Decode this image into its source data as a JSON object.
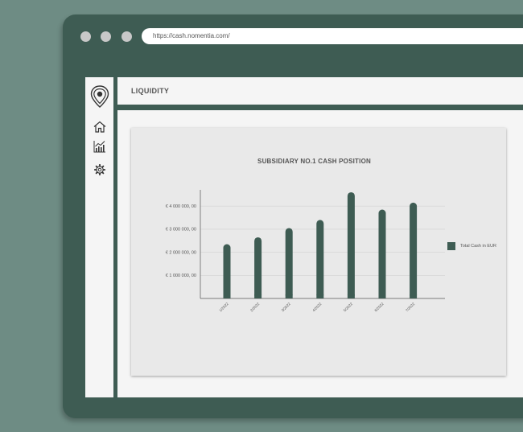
{
  "browser": {
    "url": "https://cash.nomentia.com/"
  },
  "sidebar": {
    "items": [
      {
        "icon": "location-pin-logo-icon"
      },
      {
        "icon": "home-icon"
      },
      {
        "icon": "analytics-chart-icon"
      },
      {
        "icon": "settings-gear-icon"
      }
    ]
  },
  "header": {
    "title": "LIQUIDITY"
  },
  "colors": {
    "accent": "#3e5c53",
    "background": "#6e8c84",
    "panel": "#f5f5f5",
    "card": "#e9e9e9"
  },
  "chart_data": {
    "type": "bar",
    "title": "SUBSIDIARY NO.1 CASH POSITION",
    "categories": [
      "1/2022",
      "2/2022",
      "3/2022",
      "4/2022",
      "5/2022",
      "6/2022",
      "7/2022"
    ],
    "series": [
      {
        "name": "Total Cash in EUR",
        "values": [
          2350000,
          2650000,
          3050000,
          3400000,
          4600000,
          3850000,
          4150000
        ]
      }
    ],
    "ytick_labels": [
      "€ 1 000 000, 00",
      "€ 2 000 000, 00",
      "€ 3 000 000, 00",
      "€ 4 000 000, 00"
    ],
    "yticks": [
      1000000,
      2000000,
      3000000,
      4000000
    ],
    "ylim": [
      0,
      4800000
    ],
    "grid": true,
    "legend_position": "right"
  }
}
